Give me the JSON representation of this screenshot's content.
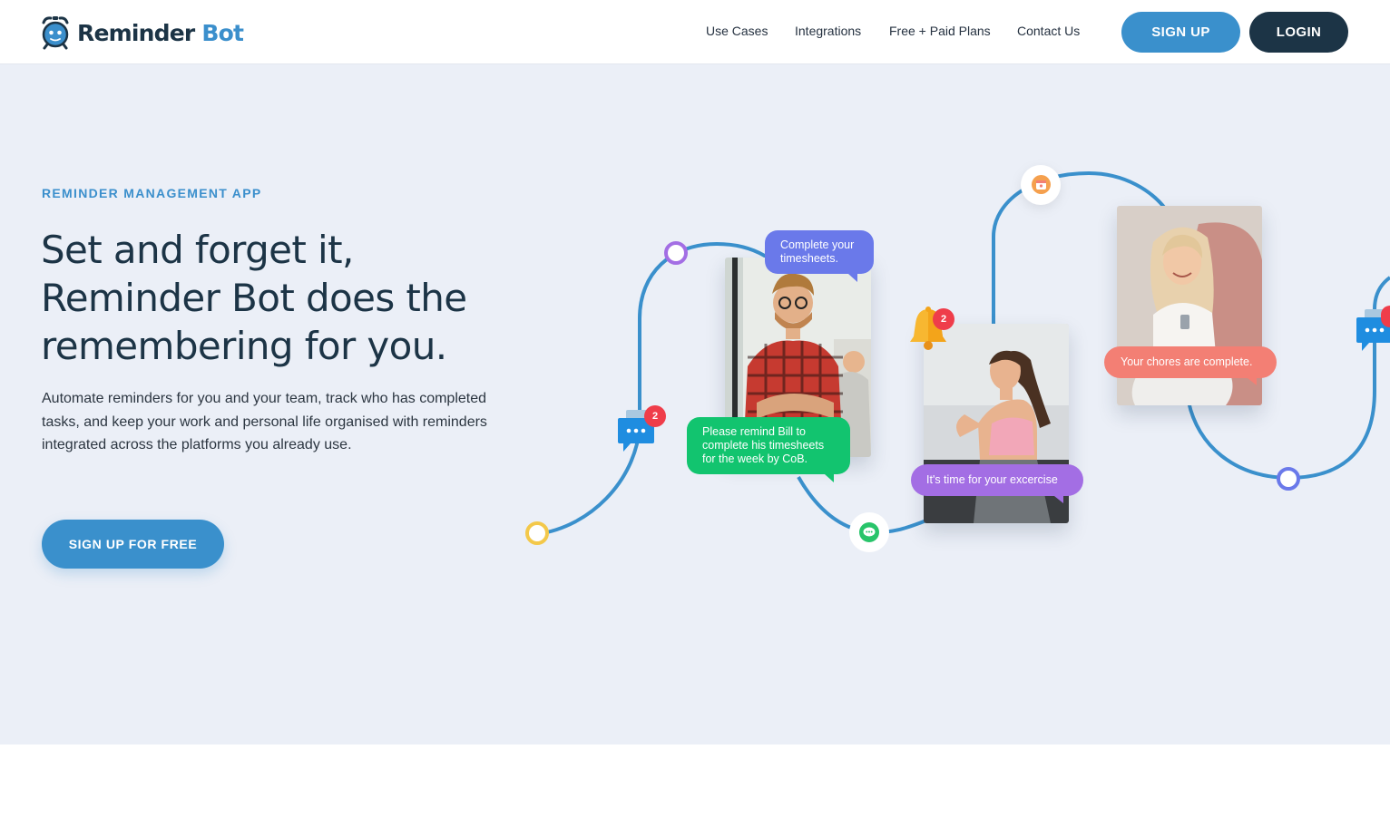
{
  "header": {
    "brand_primary": "Reminder",
    "brand_accent": "Bot",
    "nav": [
      "Use Cases",
      "Integrations",
      "Free + Paid Plans",
      "Contact Us"
    ],
    "signup_label": "SIGN UP",
    "login_label": "LOGIN"
  },
  "hero": {
    "eyebrow": "REMINDER MANAGEMENT APP",
    "headline_1": "Set and forget it,",
    "headline_2": "Reminder Bot does the",
    "headline_3": "remembering for you.",
    "description": "Automate reminders for you and your team, track who has completed tasks, and keep your work and personal life organised with reminders integrated across the platforms you already use.",
    "cta_label": "SIGN UP FOR FREE"
  },
  "illustration": {
    "bubble_timesheets": "Complete your timesheets.",
    "bubble_remind_bill": "Please remind Bill to complete his timesheets for the week by CoB.",
    "bubble_exercise": "It's time for your excercise",
    "bubble_chores": "Your chores are complete.",
    "badge_chat": "2",
    "badge_bell": "2"
  },
  "colors": {
    "brand_dark": "#1c3446",
    "brand_blue": "#3a90cc",
    "hero_bg": "#ebeff7",
    "path_blue": "#3a90cc",
    "bubble_blue": "#6a79ea",
    "bubble_green": "#12c46f",
    "bubble_purple": "#a36ee4",
    "bubble_coral": "#f37f74",
    "badge_red": "#ef3d4a"
  },
  "icons": [
    "alarm-clock-logo-icon",
    "chat-icon",
    "bell-icon",
    "calendar-icon",
    "message-icon"
  ]
}
